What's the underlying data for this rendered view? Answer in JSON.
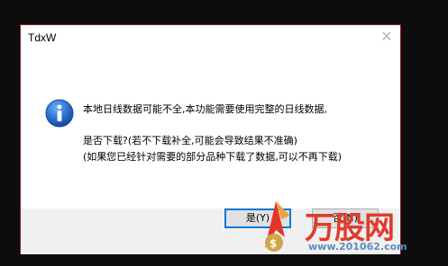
{
  "dialog": {
    "title": "TdxW",
    "close_glyph": "✕",
    "icon": "info-icon",
    "message_line1": "本地日线数据可能不全,本功能需要使用完整的日线数据,",
    "message_line2": "是否下载?(若不下载补全,可能会导致结果不准确)",
    "message_line3": "(如果您已经针对需要的部分品种下载了数据,可以不再下载)",
    "yes_label": "是(Y)",
    "no_label": "否(N)"
  },
  "watermark": {
    "logo_text": "万股网",
    "url": "www.201062.com"
  },
  "colors": {
    "accent": "#0078d7",
    "border": "#8a1a1a",
    "watermark_red": "#e03b2b",
    "watermark_blue": "#5c8dc0"
  }
}
